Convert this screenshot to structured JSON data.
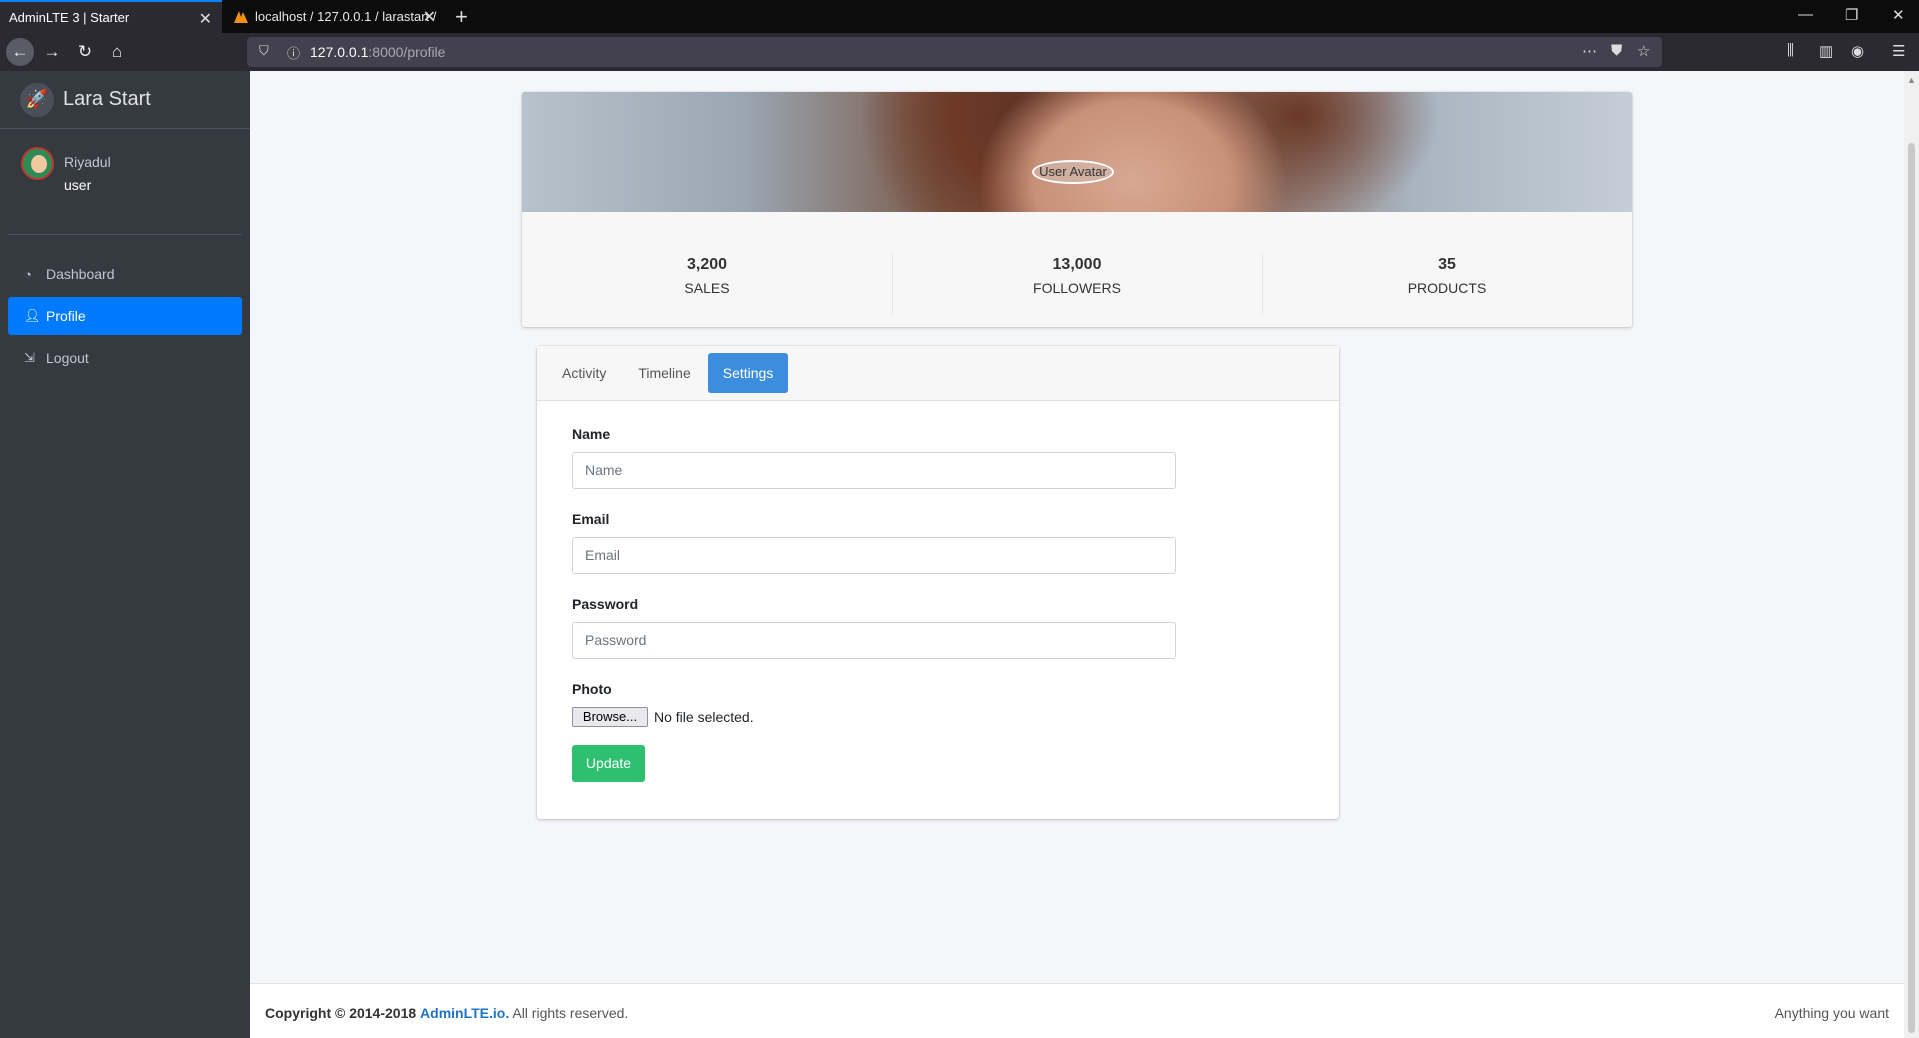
{
  "browser": {
    "tabs": [
      {
        "title": "AdminLTE 3 | Starter",
        "active": true
      },
      {
        "title": "localhost / 127.0.0.1 / larastart /",
        "active": false
      }
    ],
    "url_host": "127.0.0.1",
    "url_path": ":8000/profile"
  },
  "sidebar": {
    "brand": "Lara Start",
    "user_name": "Riyadul",
    "user_role": "user",
    "items": [
      {
        "label": "Dashboard",
        "icon": "dashboard-icon",
        "active": false
      },
      {
        "label": "Profile",
        "icon": "user-icon",
        "active": true
      },
      {
        "label": "Logout",
        "icon": "sign-out-icon",
        "active": false
      }
    ]
  },
  "profile": {
    "avatar_alt": "User Avatar",
    "stats": [
      {
        "value": "3,200",
        "label": "SALES"
      },
      {
        "value": "13,000",
        "label": "FOLLOWERS"
      },
      {
        "value": "35",
        "label": "PRODUCTS"
      }
    ]
  },
  "settings": {
    "tabs": [
      {
        "label": "Activity",
        "active": false
      },
      {
        "label": "Timeline",
        "active": false
      },
      {
        "label": "Settings",
        "active": true
      }
    ],
    "fields": {
      "name_label": "Name",
      "name_placeholder": "Name",
      "email_label": "Email",
      "email_placeholder": "Email",
      "password_label": "Password",
      "password_placeholder": "Password",
      "photo_label": "Photo"
    },
    "browse_label": "Browse...",
    "file_status": "No file selected.",
    "update_label": "Update"
  },
  "footer": {
    "copyright": "Copyright © 2014-2018",
    "link": "AdminLTE.io.",
    "rights": "All rights reserved.",
    "right_text": "Anything you want"
  },
  "colors": {
    "sidebar_bg": "#343a40",
    "active_blue": "#007bff",
    "tab_active": "#3c8dde",
    "update_green": "#2fbf71"
  }
}
